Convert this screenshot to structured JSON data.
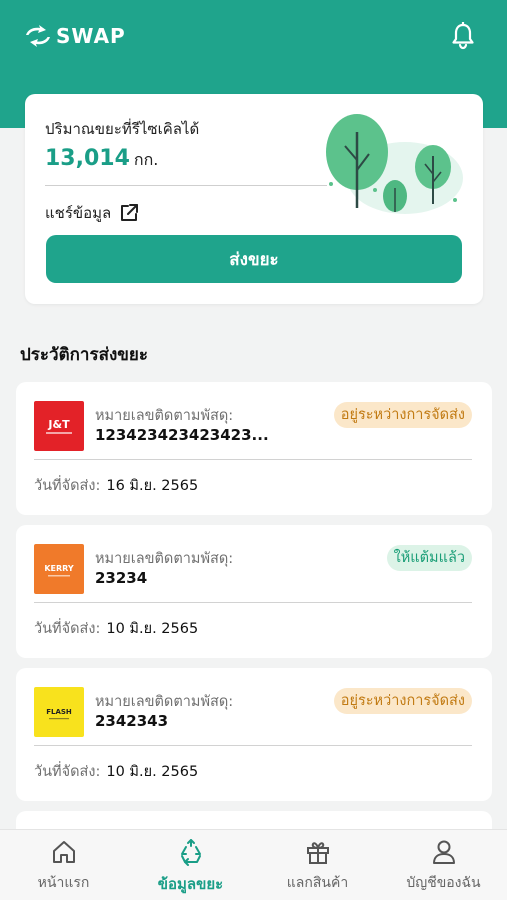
{
  "header": {
    "brand": "SWAP",
    "bell_icon": "bell-icon"
  },
  "summary": {
    "label": "ปริมาณขยะที่รีไซเคิลได้",
    "amount": "13,014",
    "unit": "กก.",
    "share_label": "แชร์ข้อมูล",
    "share_icon": "external-link-icon",
    "send_button": "ส่งขยะ"
  },
  "history": {
    "title": "ประวัติการส่งขยะ",
    "items": [
      {
        "carrier": "J&T Express",
        "logo_icon": "jt-express-logo",
        "tracking_label": "หมายเลขติดตามพัสดุ:",
        "tracking_number": "123423423423423...",
        "status": "อยู่ระหว่างการจัดส่ง",
        "status_type": "pending",
        "date_label": "วันที่จัดส่ง:",
        "date": "16 มิ.ย. 2565"
      },
      {
        "carrier": "Kerry Express",
        "logo_icon": "kerry-express-logo",
        "tracking_label": "หมายเลขติดตามพัสดุ:",
        "tracking_number": "23234",
        "status": "ให้แต้มแล้ว",
        "status_type": "done",
        "date_label": "วันที่จัดส่ง:",
        "date": "10 มิ.ย. 2565"
      },
      {
        "carrier": "Flash Express",
        "logo_icon": "flash-express-logo",
        "tracking_label": "หมายเลขติดตามพัสดุ:",
        "tracking_number": "2342343",
        "status": "อยู่ระหว่างการจัดส่ง",
        "status_type": "pending",
        "date_label": "วันที่จัดส่ง:",
        "date": "10 มิ.ย. 2565"
      }
    ]
  },
  "nav": {
    "items": [
      {
        "label": "หน้าแรก",
        "icon": "home-icon",
        "active": false
      },
      {
        "label": "ข้อมูลขยะ",
        "icon": "recycle-icon",
        "active": true
      },
      {
        "label": "แลกสินค้า",
        "icon": "gift-icon",
        "active": false
      },
      {
        "label": "บัญชีของฉัน",
        "icon": "user-icon",
        "active": false
      }
    ]
  },
  "colors": {
    "primary": "#1fa48c",
    "pending_bg": "#fbe7c9",
    "pending_text": "#c17a12",
    "done_bg": "#dcf3e7",
    "done_text": "#1a9e77"
  },
  "logos": {
    "jt_text": "J&T",
    "kerry_text": "KERRY",
    "flash_text": "FLASH"
  }
}
